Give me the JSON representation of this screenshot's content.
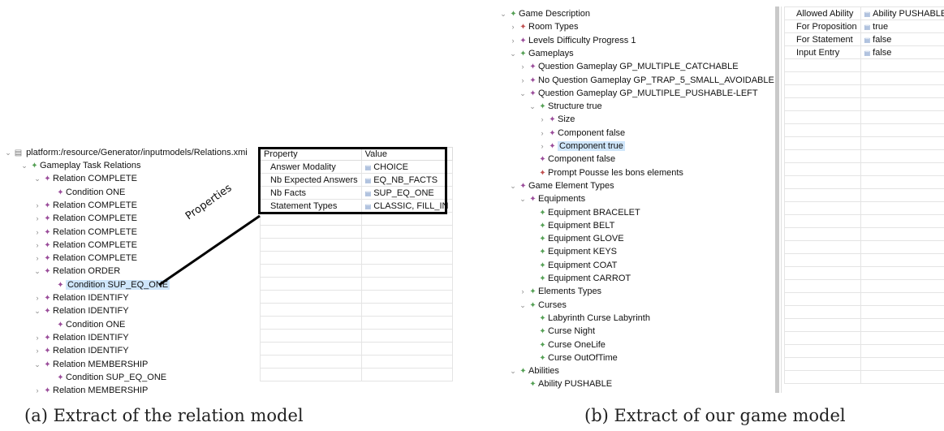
{
  "left": {
    "root_label": "platform:/resource/Generator/inputmodels/Relations.xmi",
    "tree": [
      {
        "depth": 1,
        "tw": "open",
        "icon": "green",
        "label": "Gameplay Task Relations"
      },
      {
        "depth": 2,
        "tw": "open",
        "icon": "purple",
        "label": "Relation COMPLETE"
      },
      {
        "depth": 3,
        "tw": "none",
        "icon": "purple",
        "label": "Condition ONE"
      },
      {
        "depth": 2,
        "tw": "closed",
        "icon": "purple",
        "label": "Relation COMPLETE"
      },
      {
        "depth": 2,
        "tw": "closed",
        "icon": "purple",
        "label": "Relation COMPLETE"
      },
      {
        "depth": 2,
        "tw": "closed",
        "icon": "purple",
        "label": "Relation COMPLETE"
      },
      {
        "depth": 2,
        "tw": "closed",
        "icon": "purple",
        "label": "Relation COMPLETE"
      },
      {
        "depth": 2,
        "tw": "closed",
        "icon": "purple",
        "label": "Relation COMPLETE"
      },
      {
        "depth": 2,
        "tw": "open",
        "icon": "purple",
        "label": "Relation ORDER"
      },
      {
        "depth": 3,
        "tw": "none",
        "icon": "purple",
        "label": "Condition SUP_EQ_ONE",
        "selected": true
      },
      {
        "depth": 2,
        "tw": "closed",
        "icon": "purple",
        "label": "Relation IDENTIFY"
      },
      {
        "depth": 2,
        "tw": "open",
        "icon": "purple",
        "label": "Relation IDENTIFY"
      },
      {
        "depth": 3,
        "tw": "none",
        "icon": "purple",
        "label": "Condition ONE"
      },
      {
        "depth": 2,
        "tw": "closed",
        "icon": "purple",
        "label": "Relation IDENTIFY"
      },
      {
        "depth": 2,
        "tw": "closed",
        "icon": "purple",
        "label": "Relation IDENTIFY"
      },
      {
        "depth": 2,
        "tw": "open",
        "icon": "purple",
        "label": "Relation MEMBERSHIP"
      },
      {
        "depth": 3,
        "tw": "none",
        "icon": "purple",
        "label": "Condition SUP_EQ_ONE"
      },
      {
        "depth": 2,
        "tw": "closed",
        "icon": "purple",
        "label": "Relation MEMBERSHIP"
      }
    ],
    "properties": {
      "header": [
        "Property",
        "Value"
      ],
      "rows": [
        [
          "Answer Modality",
          "CHOICE"
        ],
        [
          "Nb Expected Answers",
          "EQ_NB_FACTS"
        ],
        [
          "Nb Facts",
          "SUP_EQ_ONE"
        ],
        [
          "Statement Types",
          "CLASSIC, FILL_IN"
        ]
      ]
    },
    "annotation": "Properties",
    "caption": "(a) Extract of the relation model"
  },
  "right": {
    "tree": [
      {
        "depth": 0,
        "tw": "open",
        "icon": "green",
        "label": "Game Description"
      },
      {
        "depth": 1,
        "tw": "closed",
        "icon": "red",
        "label": "Room Types"
      },
      {
        "depth": 1,
        "tw": "closed",
        "icon": "purple",
        "label": "Levels Difficulty Progress 1"
      },
      {
        "depth": 1,
        "tw": "open",
        "icon": "green",
        "label": "Gameplays"
      },
      {
        "depth": 2,
        "tw": "closed",
        "icon": "purple",
        "label": "Question Gameplay GP_MULTIPLE_CATCHABLE"
      },
      {
        "depth": 2,
        "tw": "closed",
        "icon": "purple",
        "label": "No Question Gameplay GP_TRAP_5_SMALL_AVOIDABLE"
      },
      {
        "depth": 2,
        "tw": "open",
        "icon": "purple",
        "label": "Question Gameplay GP_MULTIPLE_PUSHABLE-LEFT"
      },
      {
        "depth": 3,
        "tw": "open",
        "icon": "green",
        "label": "Structure true"
      },
      {
        "depth": 4,
        "tw": "closed",
        "icon": "purple",
        "label": "Size"
      },
      {
        "depth": 4,
        "tw": "closed",
        "icon": "purple",
        "label": "Component false"
      },
      {
        "depth": 4,
        "tw": "closed",
        "icon": "purple",
        "label": "Component true",
        "selected": true
      },
      {
        "depth": 3,
        "tw": "none",
        "icon": "purple",
        "label": "Component false"
      },
      {
        "depth": 3,
        "tw": "none",
        "icon": "red",
        "label": "Prompt Pousse les bons elements"
      },
      {
        "depth": 1,
        "tw": "open",
        "icon": "purple",
        "label": "Game Element Types"
      },
      {
        "depth": 2,
        "tw": "open",
        "icon": "purple",
        "label": "Equipments"
      },
      {
        "depth": 3,
        "tw": "none",
        "icon": "green",
        "label": "Equipment BRACELET"
      },
      {
        "depth": 3,
        "tw": "none",
        "icon": "green",
        "label": "Equipment BELT"
      },
      {
        "depth": 3,
        "tw": "none",
        "icon": "green",
        "label": "Equipment GLOVE"
      },
      {
        "depth": 3,
        "tw": "none",
        "icon": "green",
        "label": "Equipment KEYS"
      },
      {
        "depth": 3,
        "tw": "none",
        "icon": "green",
        "label": "Equipment COAT"
      },
      {
        "depth": 3,
        "tw": "none",
        "icon": "green",
        "label": "Equipment CARROT"
      },
      {
        "depth": 2,
        "tw": "closed",
        "icon": "green",
        "label": "Elements Types"
      },
      {
        "depth": 2,
        "tw": "open",
        "icon": "green",
        "label": "Curses"
      },
      {
        "depth": 3,
        "tw": "none",
        "icon": "green",
        "label": "Labyrinth Curse Labyrinth"
      },
      {
        "depth": 3,
        "tw": "none",
        "icon": "green",
        "label": "Curse Night"
      },
      {
        "depth": 3,
        "tw": "none",
        "icon": "green",
        "label": "Curse OneLife"
      },
      {
        "depth": 3,
        "tw": "none",
        "icon": "green",
        "label": "Curse OutOfTime"
      },
      {
        "depth": 1,
        "tw": "open",
        "icon": "green",
        "label": "Abilities"
      },
      {
        "depth": 2,
        "tw": "none",
        "icon": "green",
        "label": "Ability PUSHABLE"
      }
    ],
    "properties": {
      "rows": [
        [
          "Allowed Ability",
          "Ability PUSHABLE"
        ],
        [
          "For Proposition",
          "true"
        ],
        [
          "For Statement",
          "false"
        ],
        [
          "Input Entry",
          "false"
        ]
      ]
    },
    "caption": "(b) Extract of our game model"
  },
  "colors": {
    "selection": "#cfe6fb",
    "icon_purple": "#9a4c9a",
    "icon_green": "#55a055",
    "icon_red": "#c05050",
    "value_icon": "#6c8ec2",
    "highlight_border": "#000000"
  }
}
